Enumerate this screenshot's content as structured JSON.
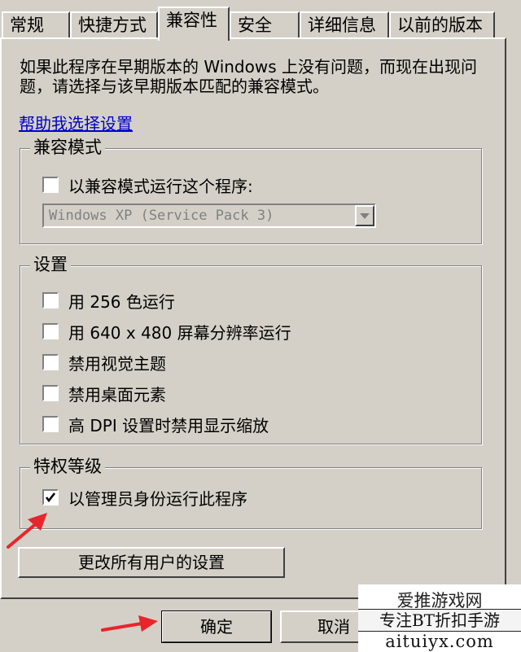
{
  "tabs": [
    {
      "label": "常规",
      "active": false
    },
    {
      "label": "快捷方式",
      "active": false
    },
    {
      "label": "兼容性",
      "active": true
    },
    {
      "label": "安全",
      "active": false
    },
    {
      "label": "详细信息",
      "active": false
    },
    {
      "label": "以前的版本",
      "active": false
    }
  ],
  "description": "如果此程序在早期版本的 Windows 上没有问题，而现在出现问题，请选择与该早期版本匹配的兼容模式。",
  "help_link": "帮助我选择设置",
  "compat_mode": {
    "title": "兼容模式",
    "checkbox_label": "以兼容模式运行这个程序:",
    "checked": false,
    "select_value": "Windows XP (Service Pack 3)"
  },
  "settings": {
    "title": "设置",
    "options": [
      {
        "label": "用 256 色运行",
        "checked": false
      },
      {
        "label": "用 640 x 480 屏幕分辨率运行",
        "checked": false
      },
      {
        "label": "禁用视觉主题",
        "checked": false
      },
      {
        "label": "禁用桌面元素",
        "checked": false
      },
      {
        "label": "高 DPI 设置时禁用显示缩放",
        "checked": false
      }
    ]
  },
  "privilege": {
    "title": "特权等级",
    "checkbox_label": "以管理员身份运行此程序",
    "checked": true
  },
  "all_users_button": "更改所有用户的设置",
  "ok_button": "确定",
  "cancel_button": "取消",
  "watermark": {
    "title": "爱推游戏网",
    "subtitle": "专注BT折扣手游",
    "url": "aituiyx.com"
  },
  "colors": {
    "window_bg": "#d4d0c8",
    "link": "#0000cc",
    "arrow": "#e8252b"
  }
}
